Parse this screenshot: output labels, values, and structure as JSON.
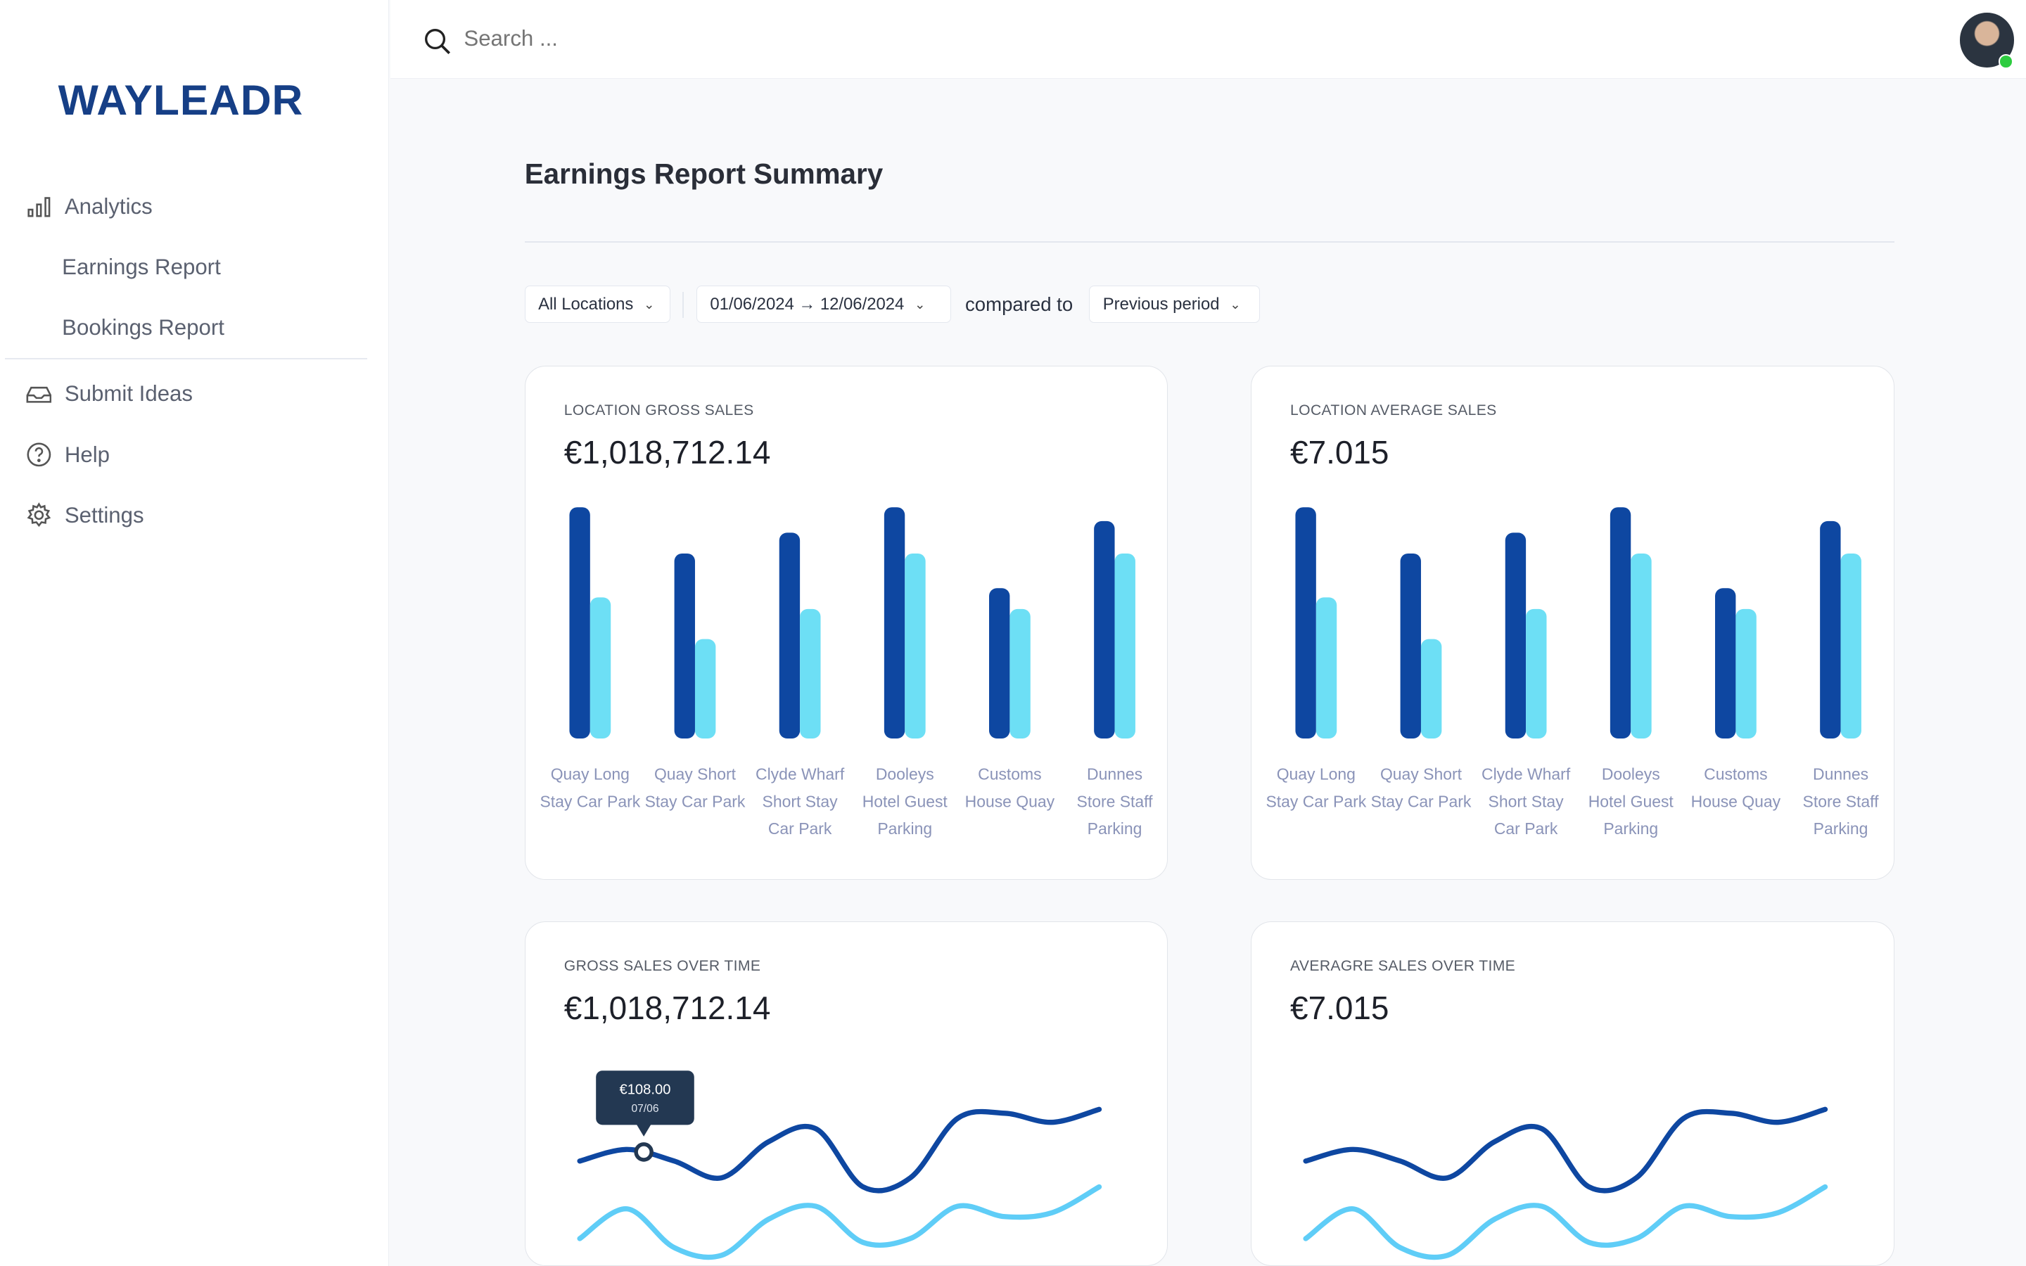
{
  "brand": {
    "logo": "WAYLEADR"
  },
  "sidebar": {
    "items": [
      {
        "label": "Analytics",
        "icon": "bar-chart-icon"
      },
      {
        "label": "Earnings Report"
      },
      {
        "label": "Bookings Report"
      },
      {
        "label": "Submit Ideas",
        "icon": "inbox-icon"
      },
      {
        "label": "Help",
        "icon": "help-circle-icon"
      },
      {
        "label": "Settings",
        "icon": "gear-icon"
      }
    ]
  },
  "topbar": {
    "search_placeholder": "Search ...",
    "avatar_status": "online"
  },
  "page": {
    "title": "Earnings Report Summary"
  },
  "filters": {
    "location": "All Locations",
    "date_range": "01/06/2024 → 12/06/2024",
    "compared_label": "compared to",
    "comparison": "Previous period"
  },
  "colors": {
    "current": "#0e47a1",
    "previous": "#6ddff5",
    "line_current": "#0e47a1",
    "line_previous": "#5fcdf7",
    "tooltip_bg": "#233852"
  },
  "cards": [
    {
      "label": "LOCATION GROSS SALES",
      "value": "€1,018,712.14"
    },
    {
      "label": "LOCATION AVERAGE SALES",
      "value": "€7.015"
    },
    {
      "label": "GROSS SALES OVER TIME",
      "value": "€1,018,712.14",
      "tooltip": {
        "value": "€108.00",
        "date": "07/06"
      }
    },
    {
      "label": "AVERAGRE SALES OVER TIME",
      "value": "€7.015"
    }
  ],
  "chart_data": [
    {
      "type": "bar",
      "categories": [
        "Quay Long Stay Car Park",
        "Quay Short Stay Car Park",
        "Clyde Wharf Short Stay Car Park",
        "Dooleys Hotel Guest Parking",
        "Customs House Quay",
        "Dunnes Store Staff Parking"
      ],
      "category_lines": [
        [
          "Quay Long",
          "Stay Car Park"
        ],
        [
          "Quay Short",
          "Stay Car Park"
        ],
        [
          "Clyde Wharf",
          "Short Stay",
          "Car Park"
        ],
        [
          "Dooleys",
          "Hotel Guest",
          "Parking"
        ],
        [
          "Customs",
          "House Quay"
        ],
        [
          "Dunnes",
          "Store Staff",
          "Parking"
        ]
      ],
      "series": [
        {
          "values": [
            100,
            80,
            89,
            100,
            65,
            94
          ]
        },
        {
          "values": [
            61,
            43,
            56,
            80,
            56,
            80
          ]
        }
      ],
      "grid": false
    },
    {
      "type": "bar",
      "categories": [
        "Quay Long Stay Car Park",
        "Quay Short Stay Car Park",
        "Clyde Wharf Short Stay Car Park",
        "Dooleys Hotel Guest Parking",
        "Customs House Quay",
        "Dunnes Store Staff Parking"
      ],
      "category_lines": [
        [
          "Quay Long",
          "Stay Car Park"
        ],
        [
          "Quay Short",
          "Stay Car Park"
        ],
        [
          "Clyde Wharf",
          "Short Stay",
          "Car Park"
        ],
        [
          "Dooleys",
          "Hotel Guest",
          "Parking"
        ],
        [
          "Customs",
          "House Quay"
        ],
        [
          "Dunnes",
          "Store Staff",
          "Parking"
        ]
      ],
      "series": [
        {
          "values": [
            100,
            80,
            89,
            100,
            65,
            94
          ]
        },
        {
          "values": [
            61,
            43,
            56,
            80,
            56,
            80
          ]
        }
      ],
      "grid": false
    },
    {
      "type": "line",
      "series": [
        {
          "values": [
            95,
            104,
            95,
            82,
            110,
            120,
            75,
            82,
            128,
            132,
            125,
            135
          ]
        },
        {
          "values": [
            35,
            58,
            28,
            22,
            50,
            60,
            32,
            35,
            60,
            52,
            55,
            75
          ]
        }
      ],
      "highlight_index": 1,
      "grid": false
    },
    {
      "type": "line",
      "series": [
        {
          "values": [
            95,
            104,
            95,
            82,
            110,
            120,
            75,
            82,
            128,
            132,
            125,
            135
          ]
        },
        {
          "values": [
            35,
            58,
            28,
            22,
            50,
            60,
            32,
            35,
            60,
            52,
            55,
            75
          ]
        }
      ],
      "grid": false
    }
  ]
}
